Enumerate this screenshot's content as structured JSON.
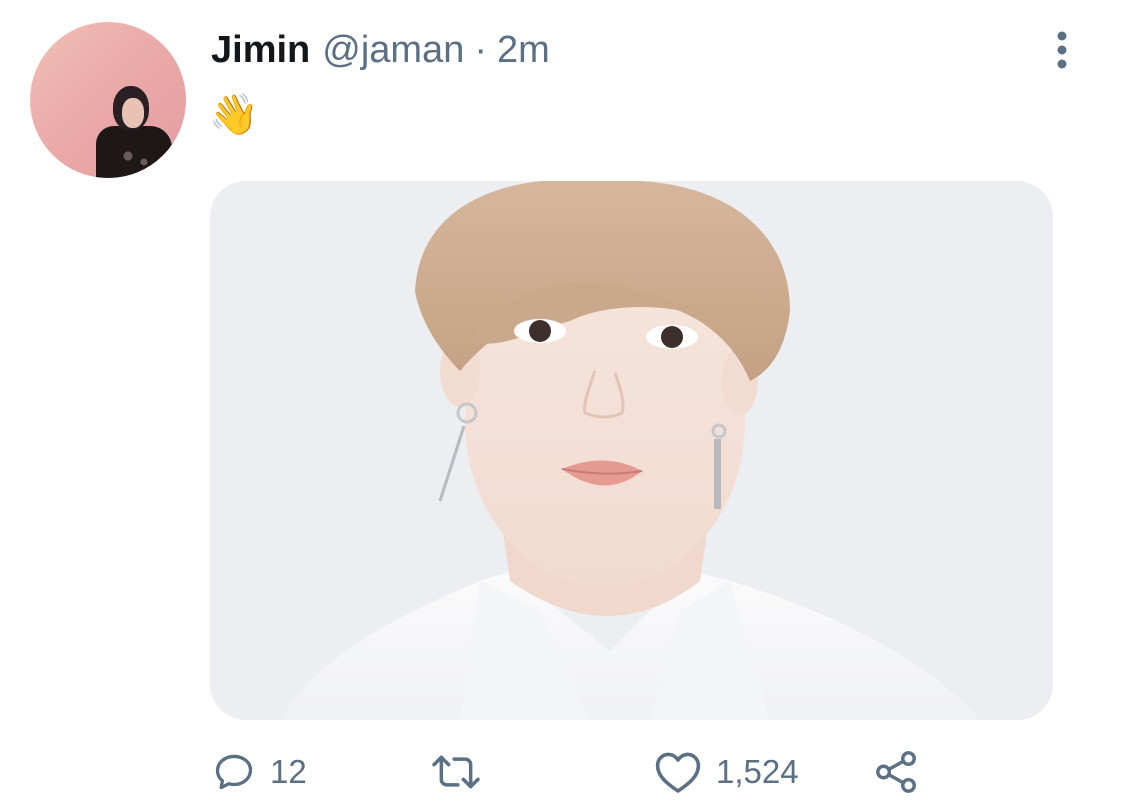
{
  "user": {
    "name": "Jimin",
    "handle": "@jaman",
    "separator": "·",
    "time": "2m"
  },
  "tweet": {
    "text": "👋"
  },
  "actions": {
    "reply_count": "12",
    "like_count": "1,524"
  },
  "icons": {
    "reply": "reply-icon",
    "retweet": "retweet-icon",
    "like": "heart-icon",
    "share": "share-icon",
    "more": "more-vertical-icon"
  },
  "colors": {
    "primary_text": "#14171a",
    "secondary_text": "#5b7083",
    "background": "#ffffff"
  }
}
